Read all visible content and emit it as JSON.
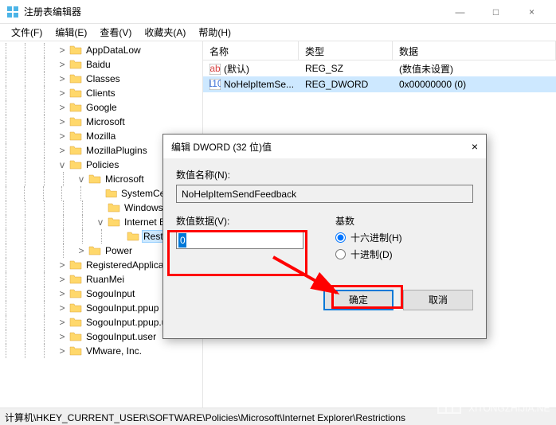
{
  "window": {
    "title": "注册表编辑器",
    "min": "—",
    "max": "□",
    "close": "×"
  },
  "menu": {
    "file": "文件(F)",
    "edit": "编辑(E)",
    "view": "查看(V)",
    "fav": "收藏夹(A)",
    "help": "帮助(H)"
  },
  "tree": [
    {
      "indent": 3,
      "toggle": ">",
      "label": "AppDataLow"
    },
    {
      "indent": 3,
      "toggle": ">",
      "label": "Baidu"
    },
    {
      "indent": 3,
      "toggle": ">",
      "label": "Classes"
    },
    {
      "indent": 3,
      "toggle": ">",
      "label": "Clients"
    },
    {
      "indent": 3,
      "toggle": ">",
      "label": "Google"
    },
    {
      "indent": 3,
      "toggle": ">",
      "label": "Microsoft"
    },
    {
      "indent": 3,
      "toggle": ">",
      "label": "Mozilla"
    },
    {
      "indent": 3,
      "toggle": ">",
      "label": "MozillaPlugins"
    },
    {
      "indent": 3,
      "toggle": "v",
      "label": "Policies"
    },
    {
      "indent": 4,
      "toggle": "v",
      "label": "Microsoft"
    },
    {
      "indent": 5,
      "toggle": "",
      "label": "SystemCertificates"
    },
    {
      "indent": 5,
      "toggle": "",
      "label": "Windows"
    },
    {
      "indent": 5,
      "toggle": "v",
      "label": "Internet Explorer"
    },
    {
      "indent": 6,
      "toggle": "",
      "label": "Restrictions",
      "selected": true
    },
    {
      "indent": 4,
      "toggle": ">",
      "label": "Power"
    },
    {
      "indent": 3,
      "toggle": ">",
      "label": "RegisteredApplications"
    },
    {
      "indent": 3,
      "toggle": ">",
      "label": "RuanMei"
    },
    {
      "indent": 3,
      "toggle": ">",
      "label": "SogouInput"
    },
    {
      "indent": 3,
      "toggle": ">",
      "label": "SogouInput.ppup"
    },
    {
      "indent": 3,
      "toggle": ">",
      "label": "SogouInput.ppup.user"
    },
    {
      "indent": 3,
      "toggle": ">",
      "label": "SogouInput.user"
    },
    {
      "indent": 3,
      "toggle": ">",
      "label": "VMware, Inc."
    }
  ],
  "list": {
    "cols": {
      "name": "名称",
      "type": "类型",
      "data": "数据"
    },
    "rows": [
      {
        "icon": "sz",
        "name": "(默认)",
        "type": "REG_SZ",
        "data": "(数值未设置)"
      },
      {
        "icon": "dw",
        "name": "NoHelpItemSe...",
        "type": "REG_DWORD",
        "data": "0x00000000 (0)",
        "selected": true
      }
    ]
  },
  "status": "计算机\\HKEY_CURRENT_USER\\SOFTWARE\\Policies\\Microsoft\\Internet Explorer\\Restrictions",
  "dialog": {
    "title": "编辑 DWORD (32 位)值",
    "close": "×",
    "name_label": "数值名称(N):",
    "name_value": "NoHelpItemSendFeedback",
    "data_label": "数值数据(V):",
    "data_value": "0",
    "base_label": "基数",
    "radio_hex": "十六进制(H)",
    "radio_dec": "十进制(D)",
    "ok": "确定",
    "cancel": "取消"
  },
  "watermark": {
    "line1": "系统之家",
    "line2": "XITONGZHIJIA.NET"
  }
}
